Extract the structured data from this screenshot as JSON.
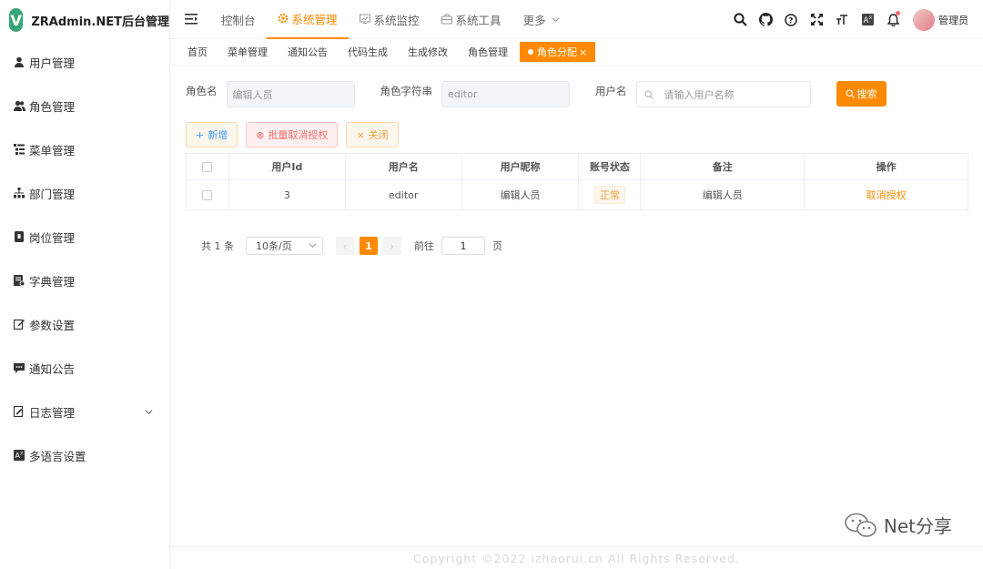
{
  "app": {
    "title": "ZRAdmin.NET后台管理",
    "logo_letter": "V"
  },
  "sidebar": {
    "items": [
      {
        "label": "用户管理",
        "icon": "user-icon"
      },
      {
        "label": "角色管理",
        "icon": "users-icon"
      },
      {
        "label": "菜单管理",
        "icon": "tree-table-icon"
      },
      {
        "label": "部门管理",
        "icon": "sitemap-icon"
      },
      {
        "label": "岗位管理",
        "icon": "post-icon"
      },
      {
        "label": "字典管理",
        "icon": "dict-icon"
      },
      {
        "label": "参数设置",
        "icon": "edit-icon"
      },
      {
        "label": "通知公告",
        "icon": "message-icon"
      },
      {
        "label": "日志管理",
        "icon": "log-icon"
      },
      {
        "label": "多语言设置",
        "icon": "language-icon"
      }
    ]
  },
  "topnav": {
    "items": [
      "控制台",
      "系统管理",
      "系统监控",
      "系统工具",
      "更多"
    ],
    "user": "管理员"
  },
  "tags": [
    "首页",
    "菜单管理",
    "通知公告",
    "代码生成",
    "生成修改",
    "角色管理",
    "角色分配"
  ],
  "filters": {
    "role_name_label": "角色名",
    "role_name_value": "编辑人员",
    "role_key_label": "角色字符串",
    "role_key_value": "editor",
    "username_label": "用户名",
    "username_placeholder": "请输入用户名称",
    "search_label": "搜索"
  },
  "actions": {
    "add": "新增",
    "batch_cancel": "批量取消授权",
    "close": "关闭"
  },
  "table": {
    "headers": [
      "用户Id",
      "用户名",
      "用户昵称",
      "账号状态",
      "备注",
      "操作"
    ],
    "rows": [
      {
        "id": "3",
        "username": "editor",
        "nickname": "编辑人员",
        "status": "正常",
        "remark": "编辑人员",
        "action": "取消授权"
      }
    ]
  },
  "pager": {
    "total": "共 1 条",
    "page_size": "10条/页",
    "current": "1",
    "goto": "前往",
    "goto_value": "1",
    "unit": "页"
  },
  "watermark": "Net分享",
  "footer": "Copyright ©2022 izhaorui.cn All Rights Reserved.",
  "colors": {
    "accent": "#ff8a00",
    "logo": "#3aa675"
  }
}
